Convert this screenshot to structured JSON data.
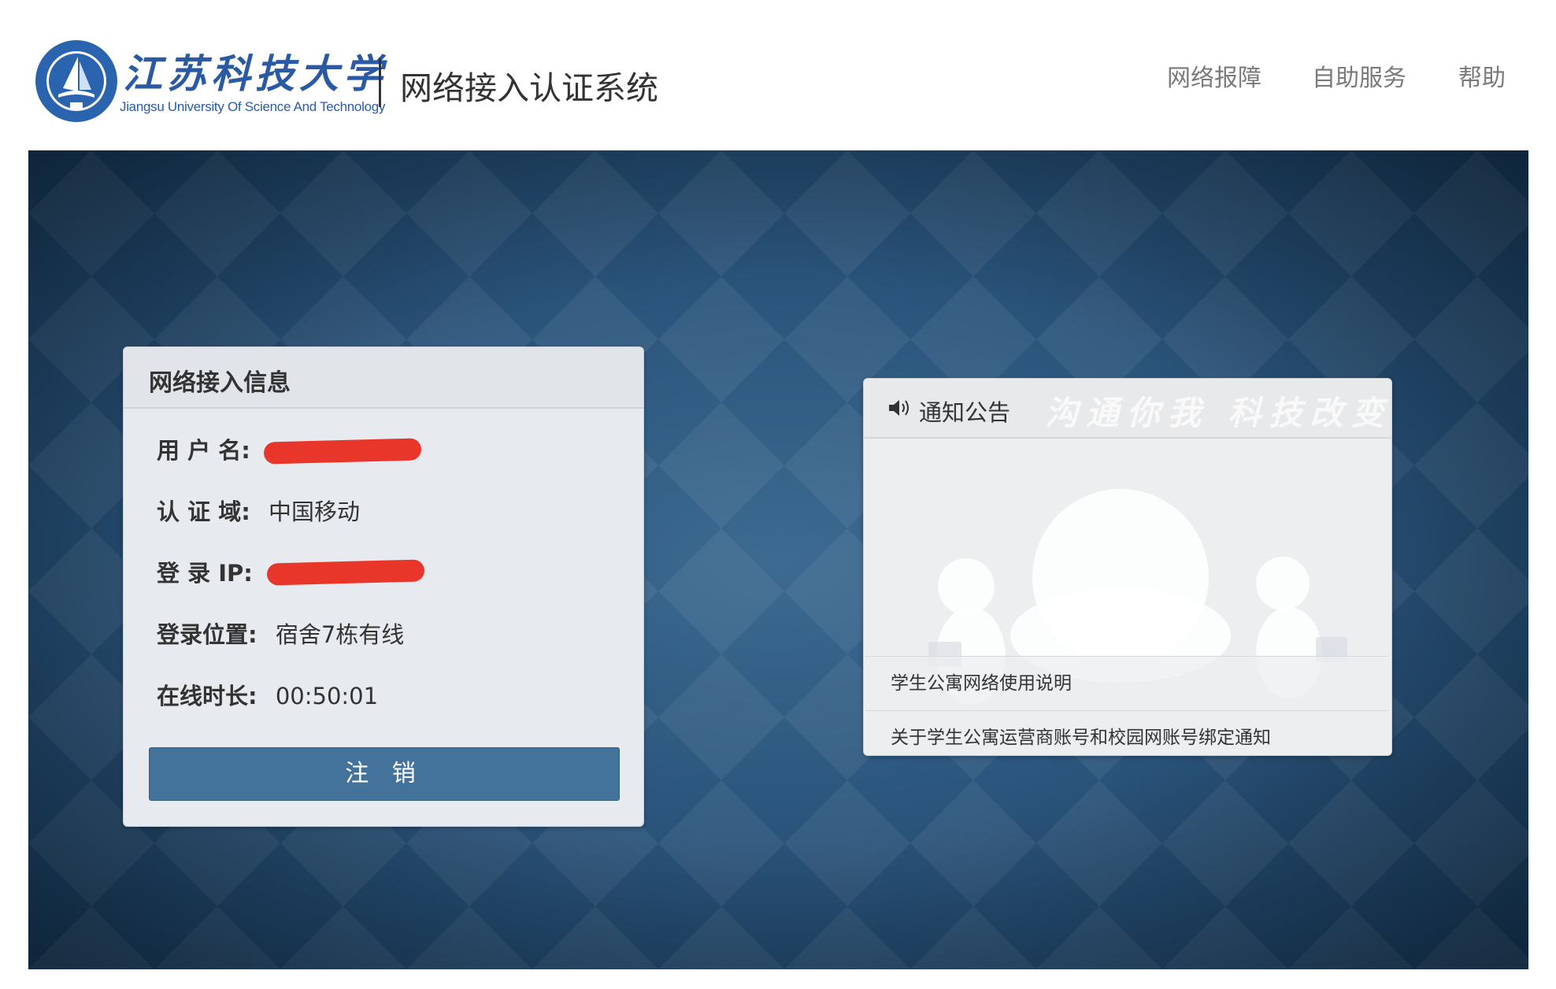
{
  "header": {
    "logo": {
      "seal_icon": "university-seal-icon",
      "name_cn": "江苏科技大学",
      "name_en": "Jiangsu University Of Science And Technology"
    },
    "system_title": "网络接入认证系统",
    "nav": [
      "网络报障",
      "自助服务",
      "帮助"
    ]
  },
  "info_panel": {
    "title": "网络接入信息",
    "fields": [
      {
        "label": "用 户 名:",
        "value": "",
        "redacted": true
      },
      {
        "label": "认 证 域:",
        "value": "中国移动"
      },
      {
        "label": "登 录 IP:",
        "value": "",
        "redacted": true
      },
      {
        "label": "登录位置:",
        "value": "宿舍7栋有线"
      },
      {
        "label": "在线时长:",
        "value": "00:50:01"
      }
    ],
    "logout_label": "注 销"
  },
  "notice_panel": {
    "icon": "speaker-icon",
    "title": "通知公告",
    "watermark": "沟通你我 科技改变生活",
    "items": [
      "学生公寓网络使用说明",
      "关于学生公寓运营商账号和校园网账号绑定通知"
    ]
  },
  "colors": {
    "banner": "#2b557c",
    "button": "#43729b",
    "redaction": "#e8362a",
    "brand": "#2a5aa6"
  }
}
